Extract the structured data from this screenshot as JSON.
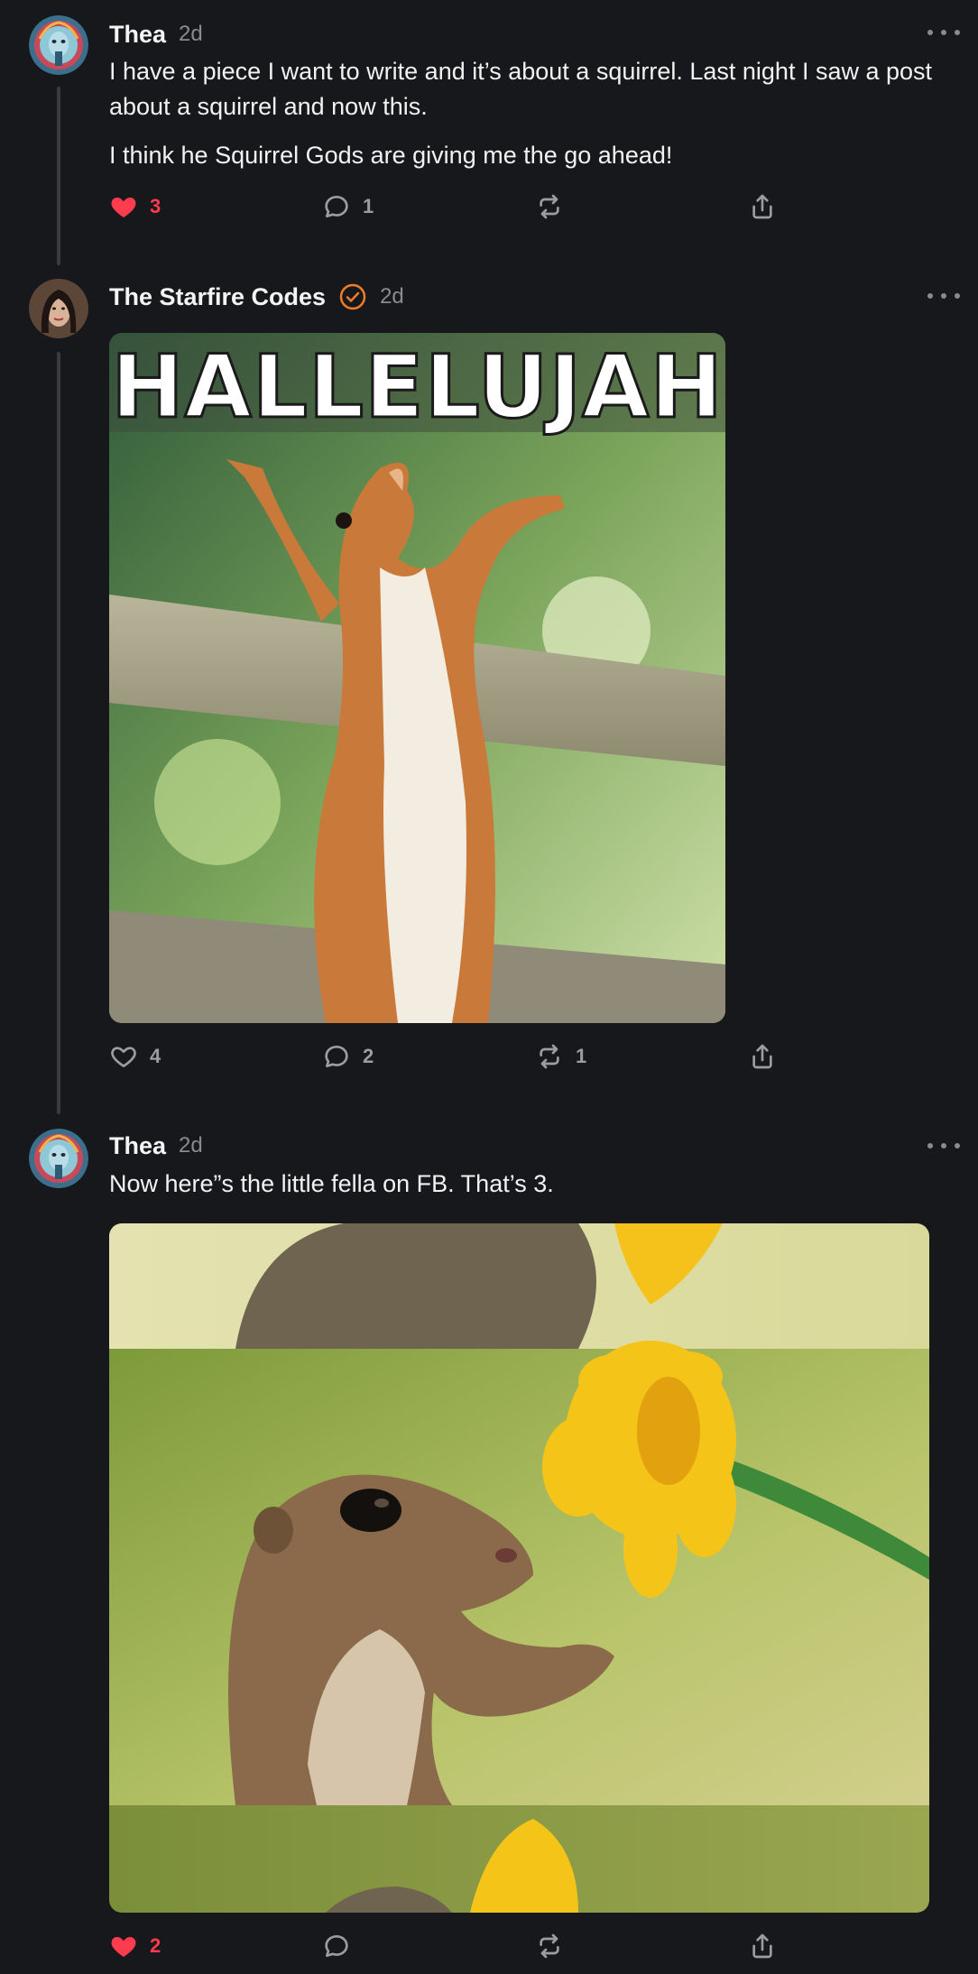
{
  "posts": [
    {
      "author": "Thea",
      "time": "2d",
      "paragraphs": [
        "I have a piece I want to write and it’s about a squirrel. Last night I saw a post about a squirrel and now this.",
        "I think he Squirrel Gods are giving me the go ahead!"
      ],
      "likes": "3",
      "replies": "1",
      "reposts": "",
      "liked": true
    },
    {
      "author": "The Starfire Codes",
      "time": "2d",
      "verified": true,
      "image_caption": "HALLELUJAH",
      "likes": "4",
      "replies": "2",
      "reposts": "1",
      "liked": false
    },
    {
      "author": "Thea",
      "time": "2d",
      "text": "Now here”s the little fella on FB. That’s 3.",
      "likes": "2",
      "replies": "",
      "reposts": "",
      "liked": true
    }
  ],
  "colors": {
    "background": "#17181b",
    "liked": "#ff3b4e",
    "verified": "#f07c2a",
    "muted": "#8a8a90"
  },
  "icons": [
    "heart-icon",
    "comment-icon",
    "repost-icon",
    "share-icon",
    "more-icon",
    "verified-icon"
  ]
}
